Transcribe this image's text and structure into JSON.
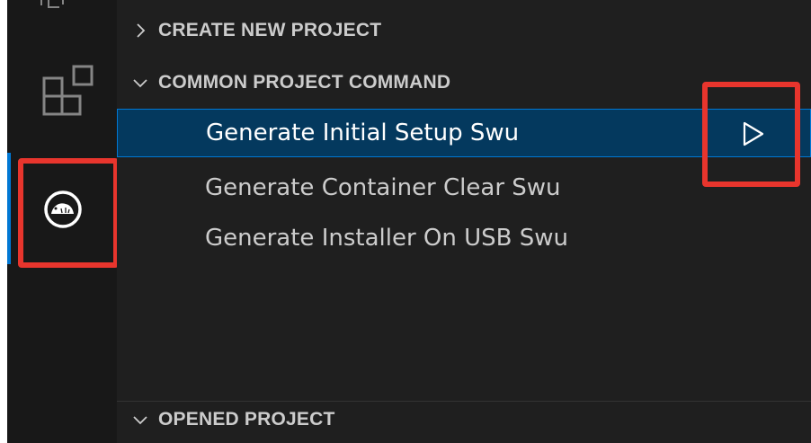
{
  "sidebar": {
    "sections": [
      {
        "title": "CREATE NEW PROJECT",
        "expanded": false,
        "icon": "chevron-right-icon"
      },
      {
        "title": "COMMON PROJECT COMMAND",
        "expanded": true,
        "icon": "chevron-down-icon"
      },
      {
        "title": "OPENED PROJECT",
        "expanded": true,
        "icon": "chevron-down-icon"
      }
    ],
    "commands": [
      {
        "label": "Generate Initial Setup Swu",
        "selected": true,
        "action_icon": "play-icon"
      },
      {
        "label": "Generate Container Clear Swu",
        "selected": false
      },
      {
        "label": "Generate Installer On USB Swu",
        "selected": false
      }
    ]
  },
  "activity_bar": {
    "icons": [
      "extensions-icon",
      "armadillo-extension-icon"
    ],
    "active": "armadillo-extension-icon"
  },
  "colors": {
    "highlight": "#e8352d",
    "selection_bg": "#04395e",
    "accent": "#0078d4",
    "sidebar_bg": "#1f1f1f",
    "activity_bg": "#181818",
    "text": "#cccccc"
  }
}
